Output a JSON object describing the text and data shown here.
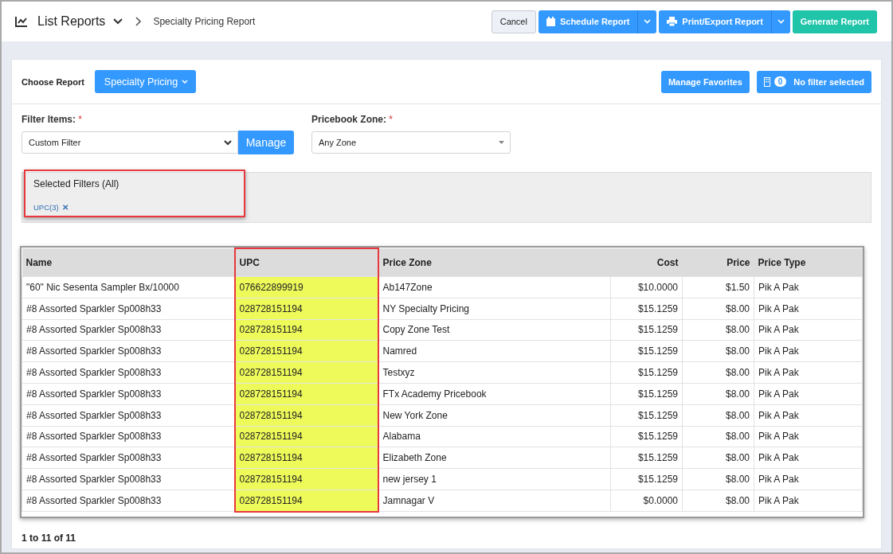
{
  "header": {
    "title": "List Reports",
    "breadcrumb": "Specialty Pricing Report",
    "buttons": [
      {
        "label": "Cancel",
        "kind": "cancel"
      },
      {
        "label": "Schedule Report",
        "kind": "schedule"
      },
      {
        "label": "Print/Export Report",
        "kind": "print"
      },
      {
        "label": "Generate Report",
        "kind": "generate"
      }
    ]
  },
  "choose_report": {
    "label": "Choose Report",
    "value": "Specialty Pricing",
    "manage_favorites": "Manage Favorites",
    "filter_count": "0",
    "filter_status": "No filter selected"
  },
  "filter_items": {
    "label": "Filter Items:",
    "required": "*",
    "value": "Custom Filter",
    "button": "Manage"
  },
  "pricebook_zone": {
    "label": "Pricebook Zone:",
    "required": "*",
    "value": "Any Zone"
  },
  "selected_filters": {
    "title": "Selected Filters (All)",
    "tags": [
      "UPC(3)"
    ],
    "remove": "✕"
  },
  "table": {
    "columns": [
      {
        "label": "Name",
        "kind": "text",
        "highlighted": false
      },
      {
        "label": "UPC",
        "kind": "text",
        "highlighted": true
      },
      {
        "label": "Price Zone",
        "kind": "text",
        "highlighted": false
      },
      {
        "label": "Cost",
        "kind": "number",
        "highlighted": false
      },
      {
        "label": "Price",
        "kind": "number",
        "highlighted": false
      },
      {
        "label": "Price Type",
        "kind": "text",
        "highlighted": false
      }
    ],
    "rows": [
      [
        "\"60\" Nic Sesenta Sampler Bx/10000",
        "076622899919",
        "Ab147Zone",
        "$10.0000",
        "$1.50",
        "Pik A Pak"
      ],
      [
        "#8 Assorted Sparkler Sp008h33",
        "028728151194",
        "NY Specialty Pricing",
        "$15.1259",
        "$8.00",
        "Pik A Pak"
      ],
      [
        "#8 Assorted Sparkler Sp008h33",
        "028728151194",
        "Copy Zone Test",
        "$15.1259",
        "$8.00",
        "Pik A Pak"
      ],
      [
        "#8 Assorted Sparkler Sp008h33",
        "028728151194",
        "Namred",
        "$15.1259",
        "$8.00",
        "Pik A Pak"
      ],
      [
        "#8 Assorted Sparkler Sp008h33",
        "028728151194",
        "Testxyz",
        "$15.1259",
        "$8.00",
        "Pik A Pak"
      ],
      [
        "#8 Assorted Sparkler Sp008h33",
        "028728151194",
        "FTx Academy Pricebook",
        "$15.1259",
        "$8.00",
        "Pik A Pak"
      ],
      [
        "#8 Assorted Sparkler Sp008h33",
        "028728151194",
        "New York Zone",
        "$15.1259",
        "$8.00",
        "Pik A Pak"
      ],
      [
        "#8 Assorted Sparkler Sp008h33",
        "028728151194",
        "Alabama",
        "$15.1259",
        "$8.00",
        "Pik A Pak"
      ],
      [
        "#8 Assorted Sparkler Sp008h33",
        "028728151194",
        "Elizabeth Zone",
        "$15.1259",
        "$8.00",
        "Pik A Pak"
      ],
      [
        "#8 Assorted Sparkler Sp008h33",
        "028728151194",
        "new jersey 1",
        "$15.1259",
        "$8.00",
        "Pik A Pak"
      ],
      [
        "#8 Assorted Sparkler Sp008h33",
        "028728151194",
        "Jamnagar V",
        "$0.0000",
        "$8.00",
        "Pik A Pak"
      ]
    ]
  },
  "pagination": "1 to 11 of 11"
}
